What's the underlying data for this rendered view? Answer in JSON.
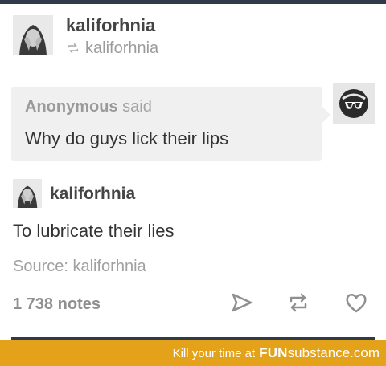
{
  "post": {
    "author": "kaliforhnia",
    "reblogged_from": "kaliforhnia"
  },
  "ask": {
    "asker": "Anonymous",
    "said": "said",
    "question": "Why do guys lick their lips"
  },
  "answer": {
    "author": "kaliforhnia",
    "text": "To lubricate their lies"
  },
  "source": "Source: kaliforhnia",
  "notes": "1 738 notes",
  "icons": [
    "send-icon",
    "reblog-icon",
    "heart-icon"
  ],
  "footer": {
    "tagline": "Kill your time at",
    "brand_bold": "FUN",
    "brand_rest": "substance",
    "brand_tld": ".com"
  },
  "colors": {
    "header_bar": "#2f3a4a",
    "footer_bg": "#e4a21a",
    "ask_bg": "#f0f0f0"
  }
}
